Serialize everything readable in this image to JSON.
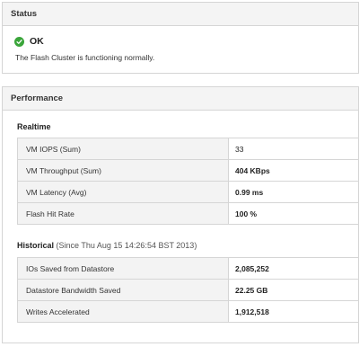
{
  "status": {
    "header": "Status",
    "state": "OK",
    "message": "The Flash Cluster is functioning normally."
  },
  "performance": {
    "header": "Performance",
    "realtime": {
      "title": "Realtime",
      "rows": [
        {
          "label": "VM IOPS (Sum)",
          "value": "33"
        },
        {
          "label": "VM Throughput (Sum)",
          "value": "404 KBps"
        },
        {
          "label": "VM Latency (Avg)",
          "value": "0.99 ms"
        },
        {
          "label": "Flash Hit Rate",
          "value": "100 %"
        }
      ]
    },
    "historical": {
      "title": "Historical",
      "subtitle": "(Since Thu Aug 15 14:26:54 BST 2013)",
      "rows": [
        {
          "label": "IOs Saved from Datastore",
          "value": "2,085,252"
        },
        {
          "label": "Datastore Bandwidth Saved",
          "value": "22.25 GB"
        },
        {
          "label": "Writes Accelerated",
          "value": "1,912,518"
        }
      ]
    }
  },
  "colors": {
    "ok_green": "#3aa53a",
    "header_bg": "#f4f4f4",
    "label_bg": "#f3f3f3",
    "border": "#d5d5d5"
  },
  "icons": {
    "status": "check-circle-icon"
  }
}
